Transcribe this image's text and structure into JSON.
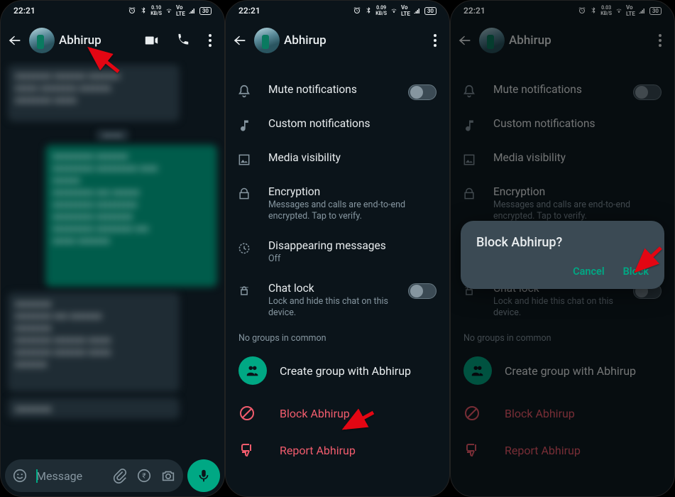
{
  "status": {
    "time": "22:21",
    "net1": "0.10",
    "net2": "0.09",
    "net3": "0.03",
    "unit": "KB/S",
    "battery": "30"
  },
  "contact": {
    "name": "Abhirup"
  },
  "input": {
    "placeholder": "Message"
  },
  "info": {
    "mute": "Mute notifications",
    "custom": "Custom notifications",
    "media": "Media visibility",
    "encryption": "Encryption",
    "encryption_sub": "Messages and calls are end-to-end encrypted. Tap to verify.",
    "disappear": "Disappearing messages",
    "disappear_sub": "Off",
    "chatlock": "Chat lock",
    "chatlock_sub": "Lock and hide this chat on this device.",
    "nogroups": "No groups in common",
    "create_group": "Create group with Abhirup",
    "block": "Block Abhirup",
    "report": "Report Abhirup"
  },
  "dialog": {
    "title": "Block Abhirup?",
    "cancel": "Cancel",
    "block": "Block"
  }
}
